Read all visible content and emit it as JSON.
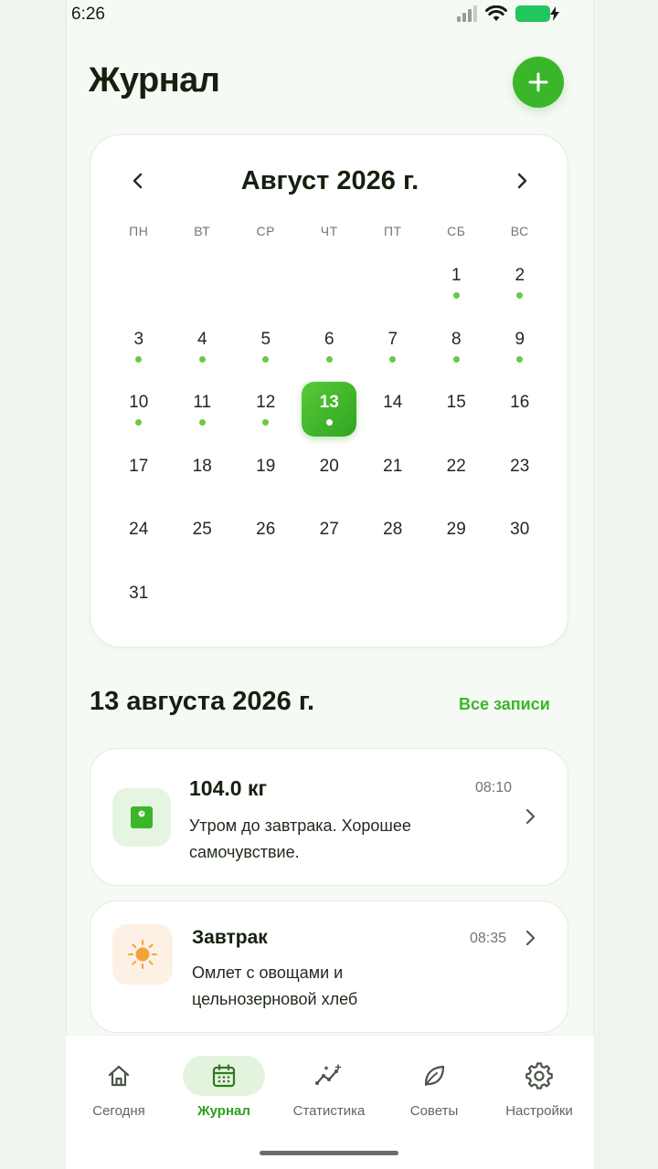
{
  "status_bar": {
    "time": "6:26"
  },
  "header": {
    "title": "Журнал"
  },
  "calendar": {
    "month_label": "Август 2026 г.",
    "weekdays": [
      "ПН",
      "ВТ",
      "СР",
      "ЧТ",
      "ПТ",
      "СБ",
      "ВС"
    ],
    "days": [
      {
        "label": ""
      },
      {
        "label": ""
      },
      {
        "label": ""
      },
      {
        "label": ""
      },
      {
        "label": ""
      },
      {
        "label": "1",
        "dot": true
      },
      {
        "label": "2",
        "dot": true
      },
      {
        "label": "3",
        "dot": true
      },
      {
        "label": "4",
        "dot": true
      },
      {
        "label": "5",
        "dot": true
      },
      {
        "label": "6",
        "dot": true
      },
      {
        "label": "7",
        "dot": true
      },
      {
        "label": "8",
        "dot": true
      },
      {
        "label": "9",
        "dot": true
      },
      {
        "label": "10",
        "dot": true
      },
      {
        "label": "11",
        "dot": true
      },
      {
        "label": "12",
        "dot": true
      },
      {
        "label": "13",
        "dot": true,
        "selected": true
      },
      {
        "label": "14"
      },
      {
        "label": "15"
      },
      {
        "label": "16"
      },
      {
        "label": "17"
      },
      {
        "label": "18"
      },
      {
        "label": "19"
      },
      {
        "label": "20"
      },
      {
        "label": "21"
      },
      {
        "label": "22"
      },
      {
        "label": "23"
      },
      {
        "label": "24"
      },
      {
        "label": "25"
      },
      {
        "label": "26"
      },
      {
        "label": "27"
      },
      {
        "label": "28"
      },
      {
        "label": "29"
      },
      {
        "label": "30"
      },
      {
        "label": "31"
      }
    ]
  },
  "day_section": {
    "title": "13 августа 2026 г.",
    "all_link": "Все записи"
  },
  "entries": [
    {
      "icon": "scale-icon",
      "title": "104.0 кг",
      "time": "08:10",
      "description": "Утром до завтрака. Хорошее самочувствие."
    },
    {
      "icon": "sun-icon",
      "title": "Завтрак",
      "time": "08:35",
      "description": "Омлет с овощами и цельнозерновой хлеб"
    }
  ],
  "nav": [
    {
      "label": "Сегодня",
      "icon": "home-icon"
    },
    {
      "label": "Журнал",
      "icon": "calendar-icon",
      "active": true
    },
    {
      "label": "Статистика",
      "icon": "stats-icon"
    },
    {
      "label": "Советы",
      "icon": "leaf-icon"
    },
    {
      "label": "Настройки",
      "icon": "gear-icon"
    }
  ],
  "colors": {
    "accent": "#3bb52a",
    "dot": "#6cc93d",
    "sun": "#f5a13a"
  }
}
